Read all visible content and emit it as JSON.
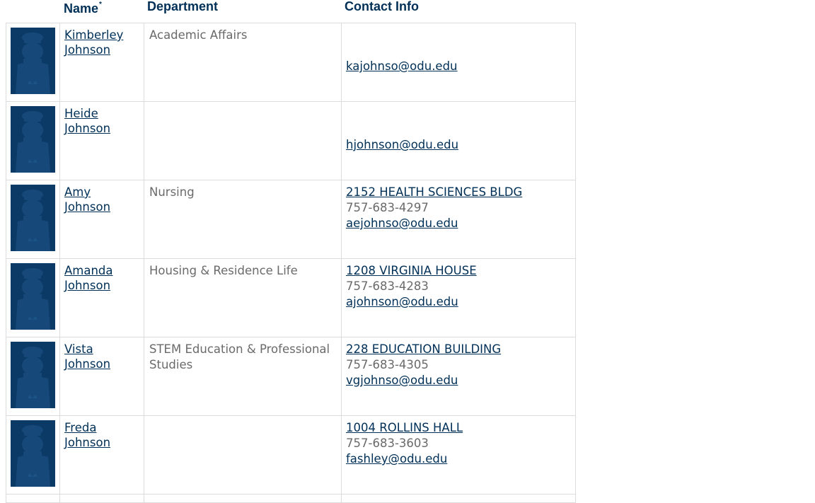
{
  "headers": {
    "name": "Name",
    "name_mark": "*",
    "department": "Department",
    "contact": "Contact Info"
  },
  "people": [
    {
      "first": "Kimberley",
      "last": "Johnson",
      "department": "Academic Affairs",
      "location": "",
      "phone": "",
      "email": "kajohnso@odu.edu"
    },
    {
      "first": "Heide",
      "last": "Johnson",
      "department": "",
      "location": "",
      "phone": "",
      "email": "hjohnson@odu.edu"
    },
    {
      "first": "Amy",
      "last": "Johnson",
      "department": "Nursing",
      "location": "2152 HEALTH SCIENCES BLDG",
      "phone": "757-683-4297",
      "email": "aejohnso@odu.edu"
    },
    {
      "first": "Amanda",
      "last": "Johnson",
      "department": "Housing & Residence Life",
      "location": "1208 VIRGINIA HOUSE",
      "phone": "757-683-4283",
      "email": "ajohnson@odu.edu"
    },
    {
      "first": "Vista",
      "last": "Johnson",
      "department": "STEM Education & Professional Studies",
      "location": "228 EDUCATION BUILDING",
      "phone": "757-683-4305",
      "email": "vgjohnso@odu.edu"
    },
    {
      "first": "Freda",
      "last": "Johnson",
      "department": "",
      "location": "1004 ROLLINS HALL",
      "phone": "757-683-3603",
      "email": "fashley@odu.edu"
    }
  ],
  "colors": {
    "link": "#003057",
    "muted_text": "#6a6a6a",
    "photo_bg": "#0b3a67",
    "border": "#dcdcdc"
  },
  "icons": {
    "photo_placeholder": "monarch-silhouette-icon"
  }
}
